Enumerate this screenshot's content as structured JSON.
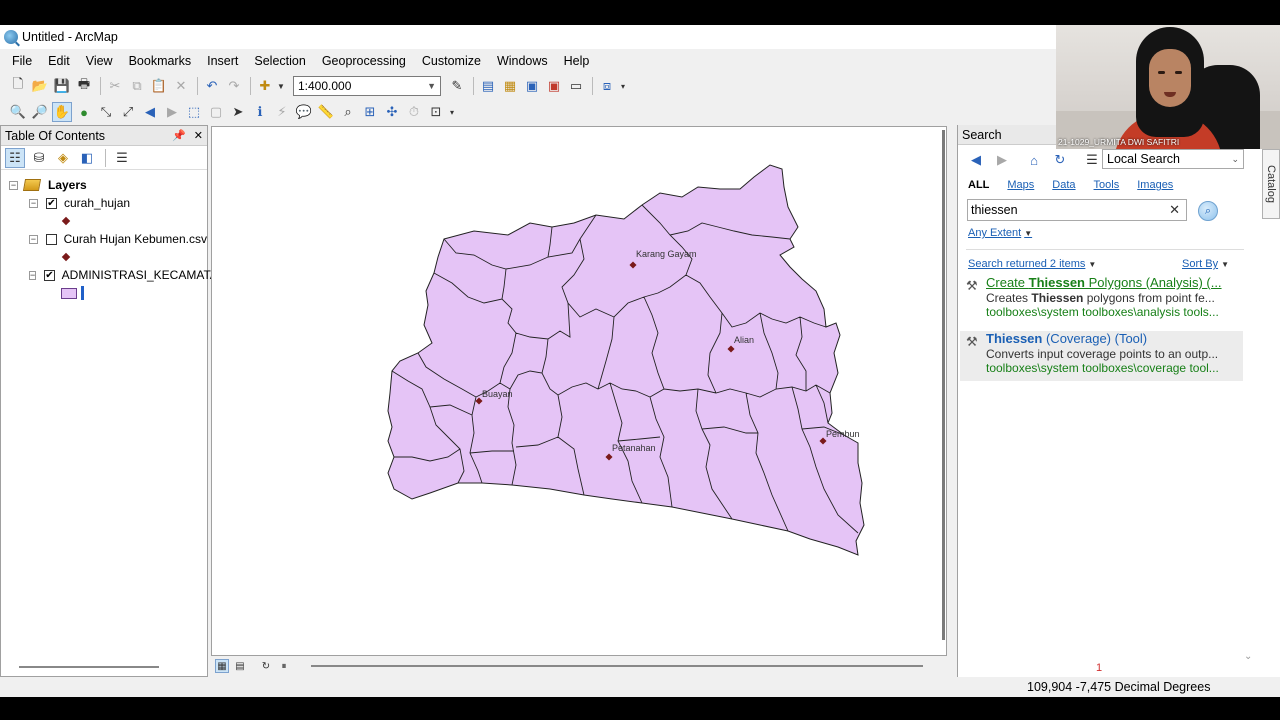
{
  "window": {
    "title": "Untitled - ArcMap"
  },
  "menu": [
    "File",
    "Edit",
    "View",
    "Bookmarks",
    "Insert",
    "Selection",
    "Geoprocessing",
    "Customize",
    "Windows",
    "Help"
  ],
  "toolbar": {
    "scale_value": "1:400.000"
  },
  "toc": {
    "title": "Table Of Contents",
    "root_label": "Layers",
    "layers": [
      {
        "name": "curah_hujan",
        "checked": true,
        "symbol": "point"
      },
      {
        "name": "Curah Hujan Kebumen.csv",
        "checked": false,
        "symbol": "point"
      },
      {
        "name": "ADMINISTRASI_KECAMATA",
        "checked": true,
        "symbol": "polygon"
      }
    ]
  },
  "map": {
    "polygon_fill": "#e5c4f6",
    "polygon_stroke": "#222222",
    "point_color": "#7a1a1a",
    "labels": [
      "Karang Gayam",
      "Alian",
      "Buayan",
      "Petanahan",
      "Pembun"
    ]
  },
  "search": {
    "panel_title": "Search",
    "scope": "Local Search",
    "tabs": [
      "ALL",
      "Maps",
      "Data",
      "Tools",
      "Images"
    ],
    "query": "thiessen",
    "extent": "Any Extent",
    "result_count": "Search returned 2 items",
    "sort_label": "Sort By",
    "results": [
      {
        "title_pre": "Create ",
        "title_hl": "Thiessen",
        "title_post": " Polygons (Analysis) (...",
        "desc_pre": "Creates ",
        "desc_hl": "Thiessen",
        "desc_post": " polygons from point fe...",
        "path": "toolboxes\\system toolboxes\\analysis tools..."
      },
      {
        "title_pre": "",
        "title_hl": "Thiessen",
        "title_post": " (Coverage) (Tool)",
        "desc_pre": "Converts input coverage points to an outp...",
        "desc_hl": "",
        "desc_post": "",
        "path": "toolboxes\\system toolboxes\\coverage tool..."
      }
    ],
    "catalog_tab": "Catalog"
  },
  "status": {
    "marker": "1",
    "coordinates": "109,904  -7,475 Decimal Degrees"
  },
  "webcam": {
    "name": "21-1029_URMITA DWI SAFITRI"
  },
  "colors": {
    "link": "#1a5fb4",
    "path_green": "#188018",
    "polygon": "#e5c4f6"
  }
}
